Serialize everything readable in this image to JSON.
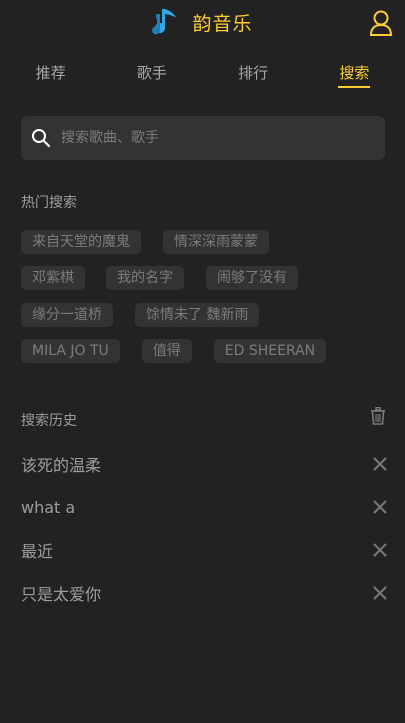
{
  "app": {
    "title": "韵音乐"
  },
  "tabs": [
    {
      "label": "推荐"
    },
    {
      "label": "歌手"
    },
    {
      "label": "排行"
    },
    {
      "label": "搜索"
    }
  ],
  "search": {
    "placeholder": "搜索歌曲、歌手"
  },
  "hot": {
    "title": "热门搜索",
    "rows": [
      [
        "来自天堂的魔鬼",
        "情深深雨蒙蒙"
      ],
      [
        "邓紫棋",
        "我的名字",
        "闹够了没有"
      ],
      [
        "缘分一道桥",
        "馀情未了 魏新雨"
      ],
      [
        "MILA JO TU",
        "值得",
        "ED SHEERAN"
      ]
    ]
  },
  "history": {
    "title": "搜索历史",
    "items": [
      "该死的温柔",
      "what a",
      "最近",
      "只是太爱你"
    ]
  },
  "colors": {
    "accent": "#ffcd32",
    "background": "#222222",
    "tag_bg": "#333333",
    "logo": "#31a9e0"
  }
}
